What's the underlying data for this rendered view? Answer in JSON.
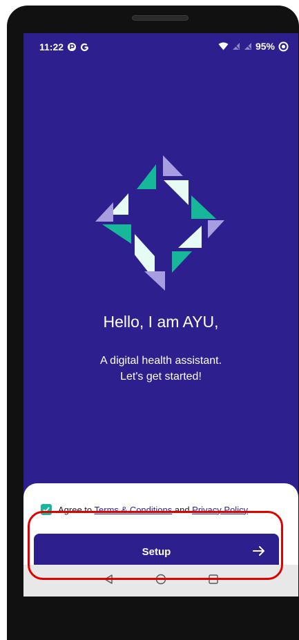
{
  "status_bar": {
    "time": "11:22",
    "left_icons": [
      "data-saver-icon",
      "google-icon"
    ],
    "battery": "95%",
    "right_icons": [
      "wifi-icon",
      "no-signal-icon",
      "no-signal-icon",
      "focus-icon"
    ]
  },
  "welcome": {
    "headline": "Hello, I am AYU,",
    "subtitle_line1": "A digital health assistant.",
    "subtitle_line2": "Let's get started!"
  },
  "consent": {
    "checked": true,
    "prefix": "Agree to ",
    "terms_link": "Terms & Conditions",
    "middle": " and ",
    "privacy_link": "Privacy Policy"
  },
  "setup_button": {
    "label": "Setup",
    "icon": "arrow-right-icon"
  },
  "nav_bar": {
    "icons": [
      "back-icon",
      "home-icon",
      "recents-icon"
    ]
  },
  "colors": {
    "primary": "#2e1f8f",
    "accent_green": "#17b79a",
    "logo_lavender": "#a79de0",
    "logo_white": "#e6fbf3",
    "highlight": "#e00000"
  }
}
